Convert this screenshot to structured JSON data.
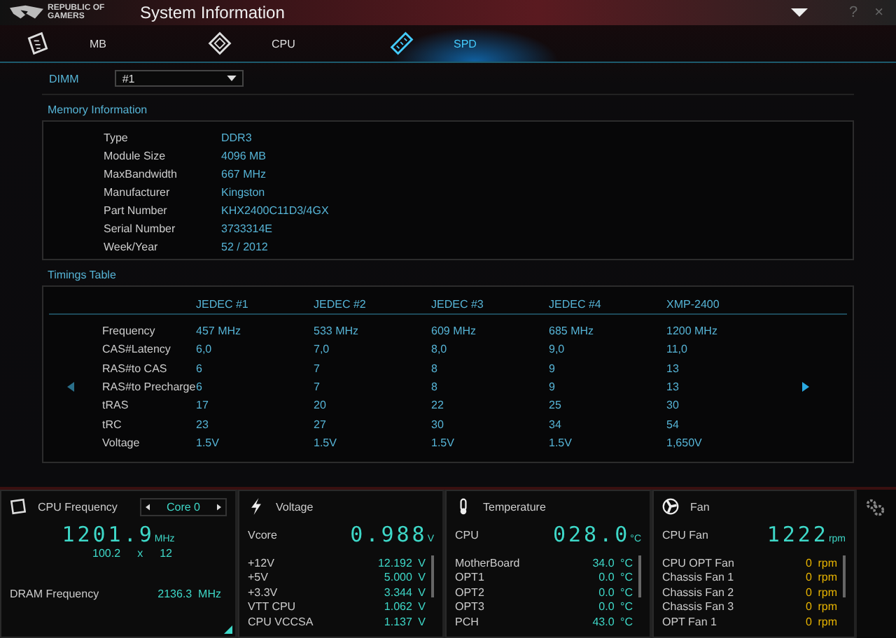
{
  "window": {
    "logo_lines": [
      "REPUBLIC OF",
      "GAMERS"
    ],
    "title": "System Information",
    "help": "?",
    "close": "×"
  },
  "tabs": [
    {
      "label": "MB",
      "kind": "board",
      "selected": false
    },
    {
      "label": "CPU",
      "kind": "chip",
      "selected": false
    },
    {
      "label": "SPD",
      "kind": "memory",
      "selected": true
    }
  ],
  "dimm": {
    "label": "DIMM",
    "value": "#1"
  },
  "memory_information": {
    "title": "Memory Information",
    "rows": [
      {
        "label": "Type",
        "value": "DDR3"
      },
      {
        "label": "Module Size",
        "value": "4096 MB"
      },
      {
        "label": "MaxBandwidth",
        "value": "667 MHz"
      },
      {
        "label": "Manufacturer",
        "value": "Kingston"
      },
      {
        "label": "Part Number",
        "value": "KHX2400C11D3/4GX"
      },
      {
        "label": "Serial Number",
        "value": "3733314E"
      },
      {
        "label": "Week/Year",
        "value": "52 / 2012"
      }
    ]
  },
  "timings_table": {
    "title": "Timings Table",
    "columns": [
      "JEDEC #1",
      "JEDEC #2",
      "JEDEC #3",
      "JEDEC #4",
      "XMP-2400"
    ],
    "rows": [
      {
        "label": "Frequency",
        "values": [
          "457 MHz",
          "533 MHz",
          "609 MHz",
          "685 MHz",
          "1200 MHz"
        ]
      },
      {
        "label": "CAS#Latency",
        "values": [
          "6,0",
          "7,0",
          "8,0",
          "9,0",
          "11,0"
        ]
      },
      {
        "label": "RAS#to CAS",
        "values": [
          "6",
          "7",
          "8",
          "9",
          "13"
        ]
      },
      {
        "label": "RAS#to Precharge",
        "values": [
          "6",
          "7",
          "8",
          "9",
          "13"
        ]
      },
      {
        "label": "tRAS",
        "values": [
          "17",
          "20",
          "22",
          "25",
          "30"
        ]
      },
      {
        "label": "tRC",
        "values": [
          "23",
          "27",
          "30",
          "34",
          "54"
        ]
      },
      {
        "label": "Voltage",
        "values": [
          "1.5V",
          "1.5V",
          "1.5V",
          "1.5V",
          "1,650V"
        ]
      }
    ]
  },
  "cpu_frequency": {
    "title": "CPU Frequency",
    "core": "Core 0",
    "value": "1201.9",
    "unit": "MHz",
    "base_clock": "100.2",
    "times": "x",
    "ratio": "12",
    "dram_label": "DRAM Frequency",
    "dram_value": "2136.3",
    "dram_unit": "MHz"
  },
  "voltage": {
    "title": "Voltage",
    "main": {
      "label": "Vcore",
      "value": "0.988",
      "unit": "V"
    },
    "rows": [
      {
        "label": "+12V",
        "value": "12.192",
        "unit": "V"
      },
      {
        "label": "+5V",
        "value": "5.000",
        "unit": "V"
      },
      {
        "label": "+3.3V",
        "value": "3.344",
        "unit": "V"
      },
      {
        "label": "VTT CPU",
        "value": "1.062",
        "unit": "V"
      },
      {
        "label": "CPU VCCSA",
        "value": "1.137",
        "unit": "V"
      }
    ]
  },
  "temperature": {
    "title": "Temperature",
    "main": {
      "label": "CPU",
      "value": "028.0",
      "unit": "°C"
    },
    "rows": [
      {
        "label": "MotherBoard",
        "value": "34.0",
        "unit": "°C"
      },
      {
        "label": "OPT1",
        "value": "0.0",
        "unit": "°C"
      },
      {
        "label": "OPT2",
        "value": "0.0",
        "unit": "°C"
      },
      {
        "label": "OPT3",
        "value": "0.0",
        "unit": "°C"
      },
      {
        "label": "PCH",
        "value": "43.0",
        "unit": "°C"
      }
    ]
  },
  "fan": {
    "title": "Fan",
    "main": {
      "label": "CPU Fan",
      "value": "1222",
      "unit": "rpm"
    },
    "rows": [
      {
        "label": "CPU OPT Fan",
        "value": "0",
        "unit": "rpm"
      },
      {
        "label": "Chassis Fan 1",
        "value": "0",
        "unit": "rpm"
      },
      {
        "label": "Chassis Fan 2",
        "value": "0",
        "unit": "rpm"
      },
      {
        "label": "Chassis Fan 3",
        "value": "0",
        "unit": "rpm"
      },
      {
        "label": "OPT Fan 1",
        "value": "0",
        "unit": "rpm"
      }
    ]
  }
}
